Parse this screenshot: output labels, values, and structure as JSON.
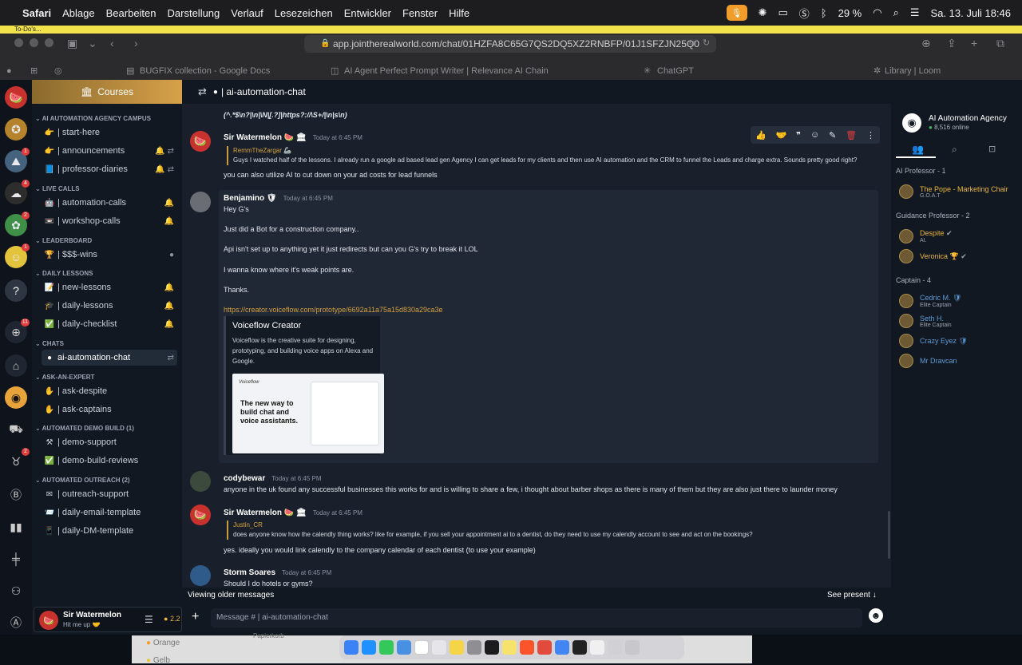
{
  "menubar": {
    "app": "Safari",
    "items": [
      "Ablage",
      "Bearbeiten",
      "Darstellung",
      "Verlauf",
      "Lesezeichen",
      "Entwickler",
      "Fenster",
      "Hilfe"
    ],
    "battery": "29 %",
    "datetime": "Sa. 13. Juli  18:46"
  },
  "todo_label": "To-Do's...",
  "browser": {
    "url": "app.jointherealworld.com/chat/01HZFA8C65G7QS2DQ5XZ2RNBFP/01J1SFZJN25Q0",
    "tabs": [
      "BUGFIX collection - Google Docs",
      "AI Agent Perfect Prompt Writer | Relevance AI Chain",
      "ChatGPT",
      "Library | Loom"
    ]
  },
  "server_badges": [
    "1",
    "4",
    "2",
    "1",
    "11",
    "2"
  ],
  "channels": {
    "courses": "Courses",
    "campus": "AI AUTOMATION AGENCY CAMPUS",
    "campus_items": [
      "| start-here",
      "| announcements",
      "| professor-diaries"
    ],
    "live_calls": "LIVE CALLS",
    "live_items": [
      "| automation-calls",
      "| workshop-calls"
    ],
    "leaderboard": "LEADERBOARD",
    "leader_items": [
      "| $$$-wins"
    ],
    "daily": "DAILY LESSONS",
    "daily_items": [
      "| new-lessons",
      "| daily-lessons",
      "| daily-checklist"
    ],
    "chats": "CHATS",
    "chat_items": [
      "ai-automation-chat"
    ],
    "ask": "ASK-AN-EXPERT",
    "ask_items": [
      "| ask-despite",
      "| ask-captains"
    ],
    "demo": "AUTOMATED DEMO BUILD (1)",
    "demo_items": [
      "| demo-support",
      "| demo-build-reviews"
    ],
    "outreach": "AUTOMATED OUTREACH (2)",
    "outreach_items": [
      "| outreach-support",
      "| daily-email-template",
      "| daily-DM-template"
    ]
  },
  "user": {
    "name": "Sir Watermelon",
    "status": "Hit me up 🤝",
    "coins": "2.2"
  },
  "chat": {
    "title": "| ai-automation-chat",
    "regex_line": "(^.*$\\n?|\\n|\\N|[.?]|https?://\\S+/|\\n|s\\n)",
    "messages": [
      {
        "name": "Sir Watermelon 🍉 🏛",
        "time": "Today at 6:45 PM",
        "reply_name": "RemmTheZargar 🦾",
        "reply_text": "Guys I watched half of the lessons. I already run a google ad based lead gen Agency I can get leads for my clients and then use AI automation and the CRM to funnel the Leads and charge extra. Sounds pretty good right?",
        "text": "you can also utilize AI to cut down on your ad costs for lead funnels"
      },
      {
        "name": "Benjamino 🛡",
        "time": "Today at 6:45 PM",
        "lines": [
          "Hey G's",
          "Just did a Bot for a construction company..",
          "Api isn't set up to anything yet it just redirects but can you G's try to break it LOL",
          "I wanna know where it's weak points are.",
          "Thanks."
        ],
        "link": "https://creator.voiceflow.com/prototype/6692a11a75a15d830a29ca3e",
        "embed_title": "Voiceflow Creator",
        "embed_desc": "Voiceflow is the creative suite for designing, prototyping, and building voice apps on Alexa and Google.",
        "embed_brand": "Voiceflow",
        "embed_hero": "The new way to build chat and voice assistants."
      },
      {
        "name": "codybewar",
        "time": "Today at 6:45 PM",
        "text": "anyone in the uk found any successful businesses this works for and is willing to share a few, i thought about barber shops as there is many of them but they are also just there to launder money"
      },
      {
        "name": "Sir Watermelon 🍉 🏛",
        "time": "Today at 6:45 PM",
        "reply_name": "Justin_CR",
        "reply_text": "does anyone know how the calendly thing works? like for example, if you sell your appointment ai to a dentist, do they need to use my calendly account to see and act on the bookings?",
        "text": "yes. ideally you would link calendly to the company calendar of each dentist (to use your example)"
      },
      {
        "name": "Storm Soares",
        "time": "Today at 6:45 PM",
        "text": "Should I do hotels or gyms?"
      }
    ],
    "viewing_older": "Viewing older messages",
    "see_present": "See present",
    "composer_placeholder": "Message # | ai-automation-chat"
  },
  "members": {
    "server": "AI Automation Agency",
    "online": "8,516 online",
    "groups": [
      {
        "title": "AI Professor - 1",
        "members": [
          {
            "name": "The Pope - Marketing Chair",
            "sub": "G.O.A.T",
            "color": "#e8b63a"
          }
        ]
      },
      {
        "title": "Guidance Professor - 2",
        "members": [
          {
            "name": "Despite",
            "sub": "AI.",
            "color": "#e8b63a"
          },
          {
            "name": "Veronica 🏆",
            "sub": "",
            "color": "#e8b63a"
          }
        ]
      },
      {
        "title": "Captain - 4",
        "members": [
          {
            "name": "Cedric M.",
            "sub": "Elite Captain",
            "color": "#5b9bd5"
          },
          {
            "name": "Seth H.",
            "sub": "Elite Captain",
            "color": "#5b9bd5"
          },
          {
            "name": "Crazy Eyez",
            "sub": "",
            "color": "#5b9bd5"
          },
          {
            "name": "Mr Dravcan",
            "sub": "",
            "color": "#5b9bd5"
          }
        ]
      }
    ]
  },
  "finder_items": [
    "Orange",
    "Papierkorb",
    "Gelb"
  ]
}
